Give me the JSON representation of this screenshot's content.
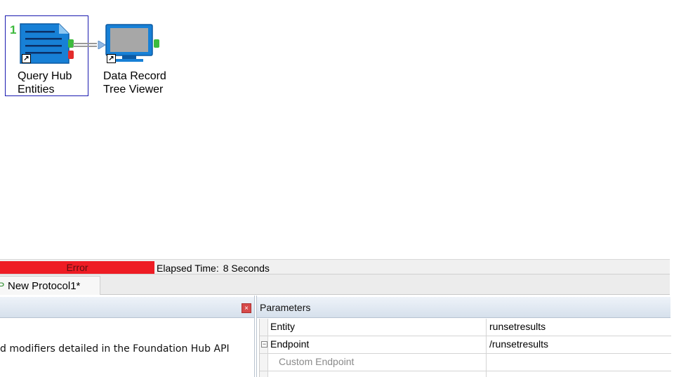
{
  "canvas": {
    "nodes": [
      {
        "number": "1",
        "label": "Query Hub\nEntities",
        "icon": "document-list-icon"
      },
      {
        "label": "Data Record\nTree Viewer",
        "icon": "monitor-icon"
      }
    ]
  },
  "status": {
    "state": "Error",
    "elapsed_label": "Elapsed Time:",
    "elapsed_value": "8 Seconds",
    "error_color": "#ee1c24"
  },
  "tabs": [
    {
      "label": "New Protocol1*",
      "icon": "protocol-icon"
    }
  ],
  "help": {
    "close_label": "×",
    "text": "d modifiers detailed in the Foundation Hub API"
  },
  "parameters": {
    "title": "Parameters",
    "rows": [
      {
        "name": "Entity",
        "value": "runsetresults"
      },
      {
        "name": "Endpoint",
        "value": "/runsetresults",
        "expander": "−"
      },
      {
        "name": "Custom Endpoint",
        "value": ""
      }
    ]
  }
}
